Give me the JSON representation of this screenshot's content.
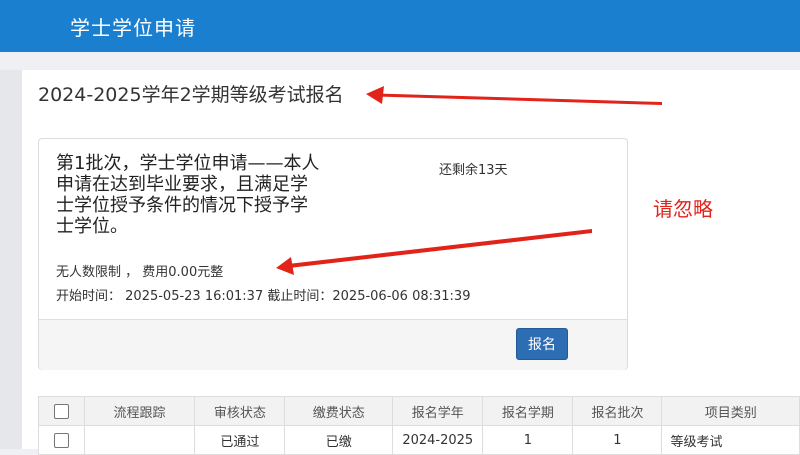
{
  "app": {
    "title": "学士学位申请"
  },
  "page": {
    "title": "2024-2025学年2学期等级考试报名"
  },
  "batch": {
    "description": "第1批次，学士学位申请——本人申请在达到毕业要求，且满足学士学位授予条件的情况下授予学士学位。",
    "remaining": "还剩余13天",
    "limit": "无人数限制 ， 费用0.00元整",
    "start_label": "开始时间：",
    "start_time": "2025-05-23 16:01:37",
    "end_label": "截止时间：",
    "end_time": "2025-06-06 08:31:39",
    "register_label": "报名"
  },
  "annotation": {
    "note": "请忽略",
    "arrow_color": "#e2231a"
  },
  "table": {
    "headers": [
      "流程跟踪",
      "审核状态",
      "缴费状态",
      "报名学年",
      "报名学期",
      "报名批次",
      "项目类别"
    ],
    "rows": [
      [
        "",
        "已通过",
        "已缴",
        "2024-2025",
        "1",
        "1",
        "等级考试"
      ]
    ]
  },
  "colors": {
    "header_bg": "#1b7fcf",
    "button_bg": "#2d6db4"
  }
}
